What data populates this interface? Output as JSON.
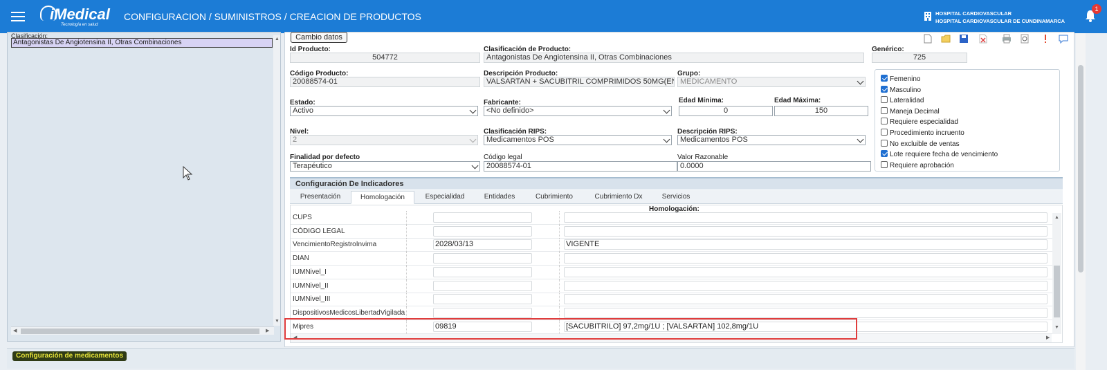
{
  "header": {
    "logo_text": "iMedical",
    "logo_tagline": "Tecnología en salud",
    "breadcrumb": "CONFIGURACION / SUMINISTROS / CREACION DE PRODUCTOS",
    "hospital_line1": "HOSPITAL CARDIOVASCULAR",
    "hospital_line2": "HOSPITAL CARDIOVASCULAR DE CUNDINAMARCA",
    "notification_count": "1",
    "colors": {
      "bar": "#1c7cd6",
      "badge": "#e53935"
    }
  },
  "left_panel": {
    "caption": "Clasificación:",
    "selected_value": "Antagonistas De Angiotensina II, Otras Combinaciones"
  },
  "toolbar": {
    "cambio_datos": "Cambio datos",
    "icons": [
      "new-document-icon",
      "open-folder-icon",
      "save-icon",
      "delete-icon",
      "print-icon",
      "preview-icon",
      "alert-icon",
      "comment-icon"
    ]
  },
  "form": {
    "id_producto": {
      "label": "Id Producto:",
      "value": "504772"
    },
    "clasificacion_producto": {
      "label": "Clasificación de Producto:",
      "value": "Antagonistas De Angiotensina II, Otras Combinaciones"
    },
    "generico": {
      "label": "Genérico:",
      "value": "725"
    },
    "codigo_producto": {
      "label": "Código Producto:",
      "value": "20088574-01"
    },
    "descripcion_producto": {
      "label": "Descripción Producto:",
      "value": "VALSARTAN + SACUBITRIL COMPRIMIDOS 50MG(EN"
    },
    "grupo": {
      "label": "Grupo:",
      "value": "MEDICAMENTO"
    },
    "estado": {
      "label": "Estado:",
      "value": "Activo"
    },
    "fabricante": {
      "label": "Fabricante:",
      "value": "<No definido>"
    },
    "edad_minima": {
      "label": "Edad Mínima:",
      "value": "0"
    },
    "edad_maxima": {
      "label": "Edad Máxima:",
      "value": "150"
    },
    "nivel": {
      "label": "Nivel:",
      "value": "2"
    },
    "clasificacion_rips": {
      "label": "Clasificación RIPS:",
      "value": "Medicamentos POS"
    },
    "descripcion_rips": {
      "label": "Descripción RIPS:",
      "value": "Medicamentos POS"
    },
    "finalidad": {
      "label": "Finalidad por defecto",
      "value": "Terapéutico"
    },
    "codigo_legal": {
      "label": "Código legal",
      "value": "20088574-01"
    },
    "valor_razonable": {
      "label": "Valor Razonable",
      "value": "0.0000"
    }
  },
  "checkboxes": [
    {
      "label": "Femenino",
      "checked": true
    },
    {
      "label": "Masculino",
      "checked": true
    },
    {
      "label": "Lateralidad",
      "checked": false
    },
    {
      "label": "Maneja Decimal",
      "checked": false
    },
    {
      "label": "Requiere especialidad",
      "checked": false
    },
    {
      "label": "Procedimiento incruento",
      "checked": false
    },
    {
      "label": "No excluible de ventas",
      "checked": false
    },
    {
      "label": "Lote requiere fecha de vencimiento",
      "checked": true
    },
    {
      "label": "Requiere aprobación",
      "checked": false
    }
  ],
  "indicadores": {
    "title": "Configuración De Indicadores",
    "tabs": [
      "Presentación",
      "Homologación",
      "Especialidad",
      "Entidades",
      "Cubrimiento",
      "Cubrimiento Dx",
      "Servicios"
    ],
    "active_tab": "Homologación",
    "grid_title": "Homologación:",
    "rows": [
      {
        "name": "CUPS",
        "value1": "",
        "value2": ""
      },
      {
        "name": "CÓDIGO LEGAL",
        "value1": "",
        "value2": ""
      },
      {
        "name": "VencimientoRegistroInvima",
        "value1": "2028/03/13",
        "value2": "VIGENTE"
      },
      {
        "name": "DIAN",
        "value1": "",
        "value2": ""
      },
      {
        "name": "IUMNivel_I",
        "value1": "",
        "value2": ""
      },
      {
        "name": "IUMNivel_II",
        "value1": "",
        "value2": ""
      },
      {
        "name": "IUMNivel_III",
        "value1": "",
        "value2": ""
      },
      {
        "name": "DispositivosMedicosLibertadVigilada",
        "value1": "",
        "value2": ""
      },
      {
        "name": "Mipres",
        "value1": "09819",
        "value2": "[SACUBITRILO] 97,2mg/1U ; [VALSARTAN] 102,8mg/1U"
      }
    ],
    "highlight_color": "#e03c3c"
  },
  "bottom": {
    "config_medicamentos": "Configuración de medicamentos"
  }
}
